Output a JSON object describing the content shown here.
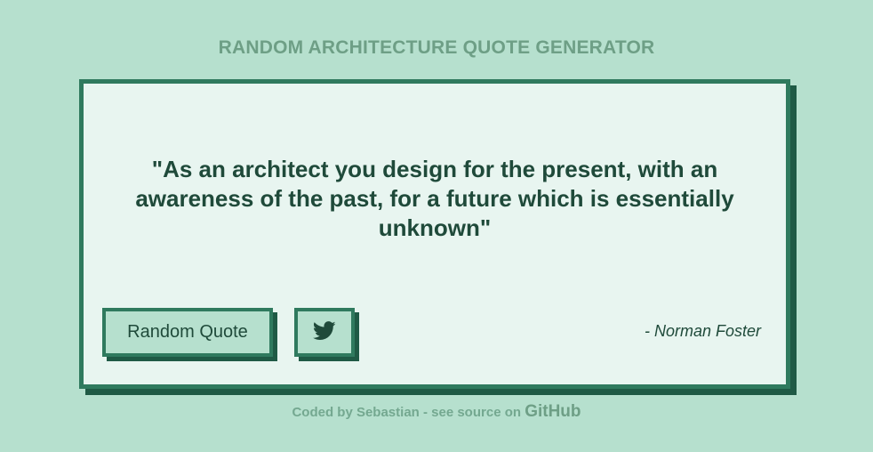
{
  "header": {
    "title": "RANDOM ARCHITECTURE QUOTE GENERATOR"
  },
  "quote": {
    "text": "\"As an architect you design for the present, with an awareness of the past, for a future which is essentially unknown\"",
    "author": "- Norman Foster"
  },
  "buttons": {
    "random_label": "Random Quote",
    "tweet_icon": "twitter-icon"
  },
  "footer": {
    "prefix": "Coded by Sebastian - see source on ",
    "link_label": "GitHub"
  },
  "colors": {
    "background": "#b6e0ce",
    "card_background": "#e8f5f0",
    "accent": "#2f7a5e",
    "shadow": "#1f5a45",
    "text": "#1f4a3a",
    "muted": "#6e9f86"
  }
}
